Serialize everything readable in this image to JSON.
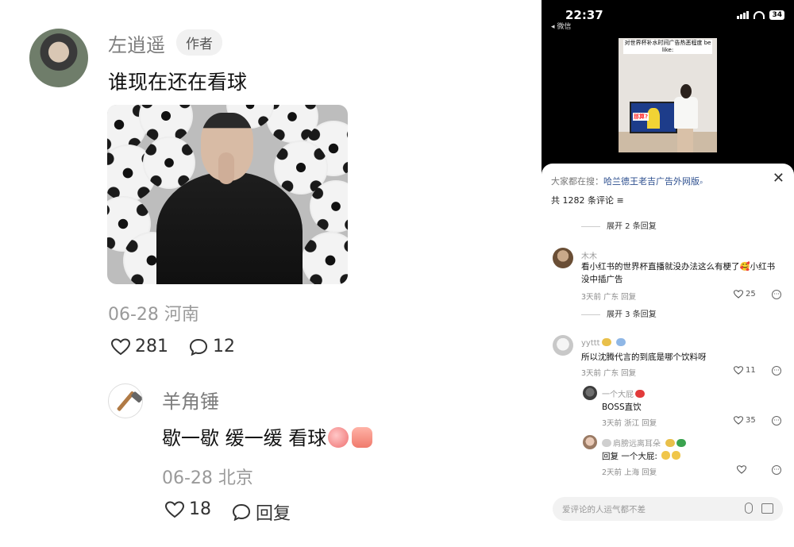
{
  "left_post": {
    "author": {
      "name": "左逍遥",
      "tag": "作者"
    },
    "text": "谁现在还在看球",
    "meta": "06-28 河南",
    "likes": "281",
    "comments": "12"
  },
  "left_reply": {
    "name": "羊角锤",
    "text": "歇一歇 缓一缓 看球",
    "meta": "06-28 北京",
    "likes": "18",
    "reply_label": "回复"
  },
  "phone": {
    "status": {
      "time": "22:37",
      "back": "◂ 微信",
      "battery": "34"
    },
    "video_caption": "对世界杯补水时间广告热恶程度 be like:",
    "tv_text": "那算?",
    "search_prefix": "大家都在搜：",
    "search_term": "哈兰德王老吉广告外网版",
    "close": "✕",
    "comment_count": "共 1282 条评论",
    "expand_1": "展开 2 条回复",
    "expand_2": "展开 3 条回复",
    "comments": [
      {
        "name": "木木",
        "text": "看小红书的世界杯直播就没办法这么有梗了🥰小红书没中插广告",
        "meta": "3天前 广东  回复",
        "likes": "25"
      },
      {
        "name": "yyttt",
        "text": "所以沈腾代言的到底是哪个饮料呀",
        "meta": "3天前 广东  回复",
        "likes": "11"
      },
      {
        "name": "一个大屁",
        "text": "BOSS直饮",
        "meta": "3天前 浙江  回复",
        "likes": "35"
      },
      {
        "name": "肩膀远离耳朵",
        "text": "回复 一个大屁:",
        "meta": "2天前 上海  回复",
        "likes": ""
      }
    ],
    "input_placeholder": "爱评论的人运气都不差"
  }
}
